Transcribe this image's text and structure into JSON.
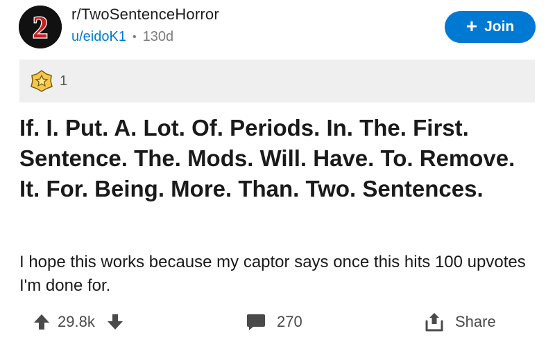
{
  "post": {
    "subreddit": "r/TwoSentenceHorror",
    "subreddit_avatar_text": "2",
    "author": "u/eidoK1",
    "separator": "•",
    "age": "130d",
    "join_label": "Join",
    "join_icon": "plus-icon",
    "awards": {
      "count": "1",
      "icon": "award-star-icon"
    },
    "title": "If. I. Put. A. Lot. Of. Periods. In. The. First. Sentence. The. Mods. Will. Have. To. Remove. It. For. Being. More. Than. Two. Sentences.",
    "body": "I hope this works because my captor says once this hits 100 upvotes I'm done for."
  },
  "actions": {
    "score": "29.8k",
    "comments": "270",
    "share_label": "Share",
    "upvote_icon": "upvote-arrow-icon",
    "downvote_icon": "downvote-arrow-icon",
    "comment_icon": "comment-bubble-icon",
    "share_icon": "share-icon"
  },
  "colors": {
    "accent": "#0079d3",
    "award_bg": "#efefef",
    "award_gold": "#f2c94c"
  }
}
